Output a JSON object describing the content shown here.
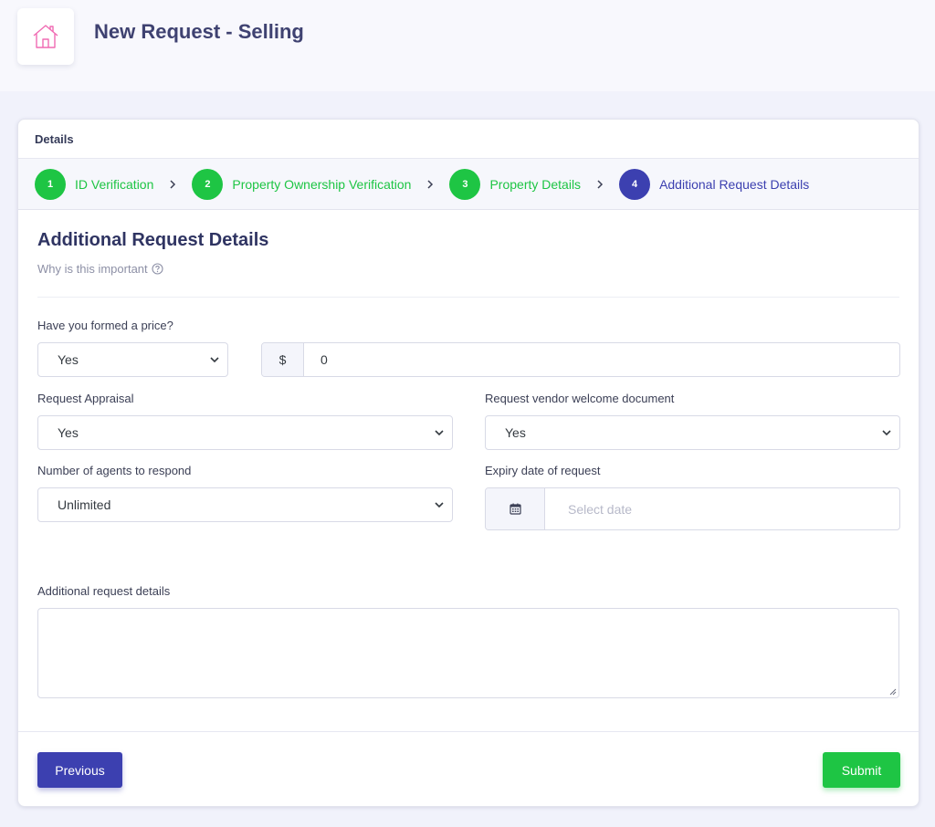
{
  "header": {
    "title": "New Request - Selling",
    "logo_icon": "house-icon"
  },
  "card": {
    "title": "Details"
  },
  "steps": [
    {
      "number": "1",
      "label": "ID Verification",
      "state": "complete"
    },
    {
      "number": "2",
      "label": "Property Ownership Verification",
      "state": "complete"
    },
    {
      "number": "3",
      "label": "Property Details",
      "state": "complete"
    },
    {
      "number": "4",
      "label": "Additional Request Details",
      "state": "active"
    }
  ],
  "section": {
    "title": "Additional Request Details",
    "why": "Why is this important"
  },
  "form": {
    "price_label": "Have you formed a price?",
    "price_select": "Yes",
    "price_currency": "$",
    "price_value": "0",
    "appraisal_label": "Request Appraisal",
    "appraisal_select": "Yes",
    "vendor_doc_label": "Request vendor welcome document",
    "vendor_doc_select": "Yes",
    "agents_label": "Number of agents to respond",
    "agents_select": "Unlimited",
    "expiry_label": "Expiry date of request",
    "expiry_placeholder": "Select date",
    "details_label": "Additional request details",
    "details_value": ""
  },
  "footer": {
    "previous_label": "Previous",
    "submit_label": "Submit"
  },
  "colors": {
    "accent": "#3c40b0",
    "success": "#1ec544",
    "logo": "#f06bb3"
  }
}
